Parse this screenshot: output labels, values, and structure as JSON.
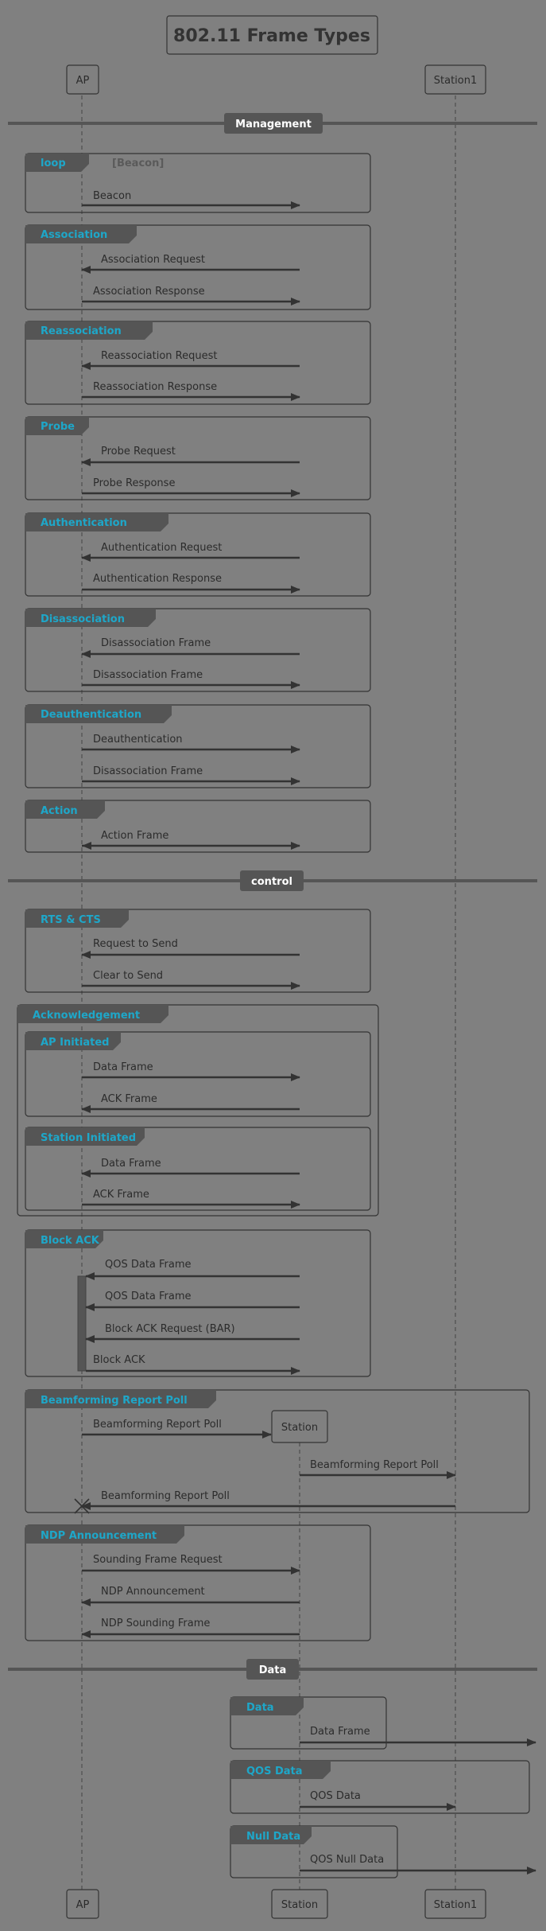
{
  "title": "802.11 Frame Types",
  "participants": {
    "ap": "AP",
    "station1": "Station1",
    "station": "Station"
  },
  "sections": {
    "management": "Management",
    "control": "control",
    "data": "Data"
  },
  "groups": {
    "loop": "loop",
    "loop_condition": "[Beacon]",
    "association": "Association",
    "reassociation": "Reassociation",
    "probe": "Probe",
    "authentication": "Authentication",
    "disassociation": "Disassociation",
    "deauthentication": "Deauthentication",
    "action": "Action",
    "rts_cts": "RTS & CTS",
    "acknowledgement": "Acknowledgement",
    "ap_initiated": "AP Initiated",
    "station_initiated": "Station Initiated",
    "block_ack": "Block ACK",
    "beamforming": "Beamforming Report Poll",
    "ndp": "NDP Announcement",
    "data": "Data",
    "qos_data": "QOS Data",
    "null_data": "Null Data"
  },
  "messages": {
    "beacon": "Beacon",
    "assoc_req": "Association Request",
    "assoc_resp": "Association Response",
    "reassoc_req": "Reassociation Request",
    "reassoc_resp": "Reassociation Response",
    "probe_req": "Probe Request",
    "probe_resp": "Probe Response",
    "auth_req": "Authentication Request",
    "auth_resp": "Authentication Response",
    "disassoc_1": "Disassociation Frame",
    "disassoc_2": "Disassociation Frame",
    "deauth": "Deauthentication",
    "deauth_disassoc": "Disassociation Frame",
    "action_frame": "Action Frame",
    "rts": "Request to Send",
    "cts": "Clear to Send",
    "ap_data": "Data Frame",
    "ap_ack": "ACK Frame",
    "st_data": "Data Frame",
    "st_ack": "ACK Frame",
    "qos_1": "QOS Data Frame",
    "qos_2": "QOS Data Frame",
    "bar": "Block ACK Request (BAR)",
    "block_ack": "Block ACK",
    "bf_1": "Beamforming Report Poll",
    "bf_2": "Beamforming Report Poll",
    "bf_3": "Beamforming Report Poll",
    "sounding": "Sounding Frame Request",
    "ndp_ann": "NDP Announcement",
    "ndp_sound": "NDP Sounding Frame",
    "data_frame": "Data Frame",
    "qos_data": "QOS Data",
    "qos_null": "QOS Null Data"
  },
  "colors": {
    "background": "#808080",
    "line": "#333333",
    "group_header": "#555555",
    "group_label": "#1ea7c9",
    "section_text": "#ffffff"
  }
}
